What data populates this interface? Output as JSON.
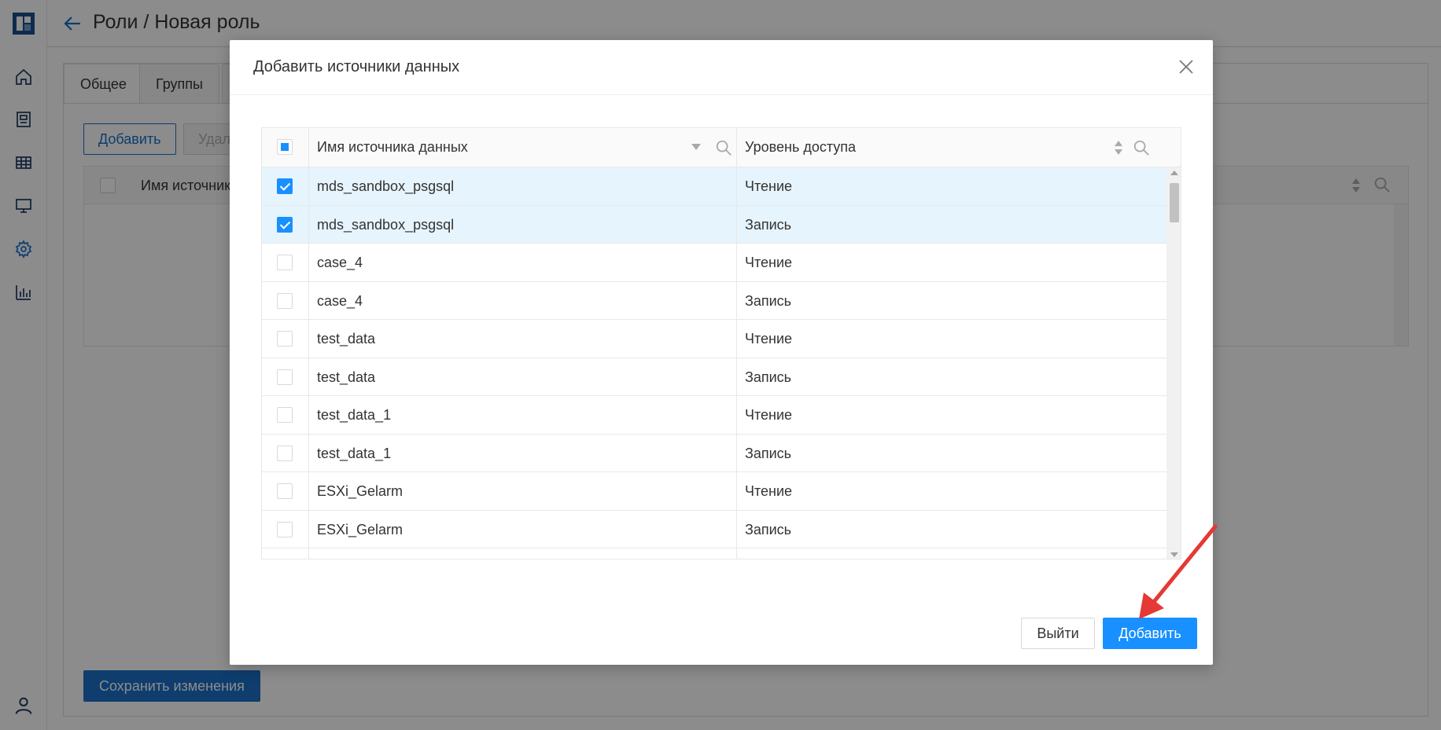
{
  "header": {
    "title": "Роли / Новая роль"
  },
  "tabs": [
    {
      "label": "Общее"
    },
    {
      "label": "Группы"
    }
  ],
  "toolbar": {
    "add_label": "Добавить",
    "delete_label": "Удал"
  },
  "bg_table": {
    "column_name": "Имя источник"
  },
  "footer": {
    "save_label": "Сохранить изменения"
  },
  "modal": {
    "title": "Добавить источники данных",
    "columns": {
      "name": "Имя источника данных",
      "level": "Уровень доступа"
    },
    "rows": [
      {
        "name": "mds_sandbox_psgsql",
        "level": "Чтение",
        "checked": true
      },
      {
        "name": "mds_sandbox_psgsql",
        "level": "Запись",
        "checked": true
      },
      {
        "name": "case_4",
        "level": "Чтение",
        "checked": false
      },
      {
        "name": "case_4",
        "level": "Запись",
        "checked": false
      },
      {
        "name": "test_data",
        "level": "Чтение",
        "checked": false
      },
      {
        "name": "test_data",
        "level": "Запись",
        "checked": false
      },
      {
        "name": "test_data_1",
        "level": "Чтение",
        "checked": false
      },
      {
        "name": "test_data_1",
        "level": "Запись",
        "checked": false
      },
      {
        "name": "ESXi_Gelarm",
        "level": "Чтение",
        "checked": false
      },
      {
        "name": "ESXi_Gelarm",
        "level": "Запись",
        "checked": false
      }
    ],
    "exit_label": "Выйти",
    "add_label": "Добавить"
  },
  "colors": {
    "accent": "#1890ff",
    "brand": "#1b6fc8",
    "annotation": "#e53935",
    "selected_row": "#e6f4fd"
  }
}
